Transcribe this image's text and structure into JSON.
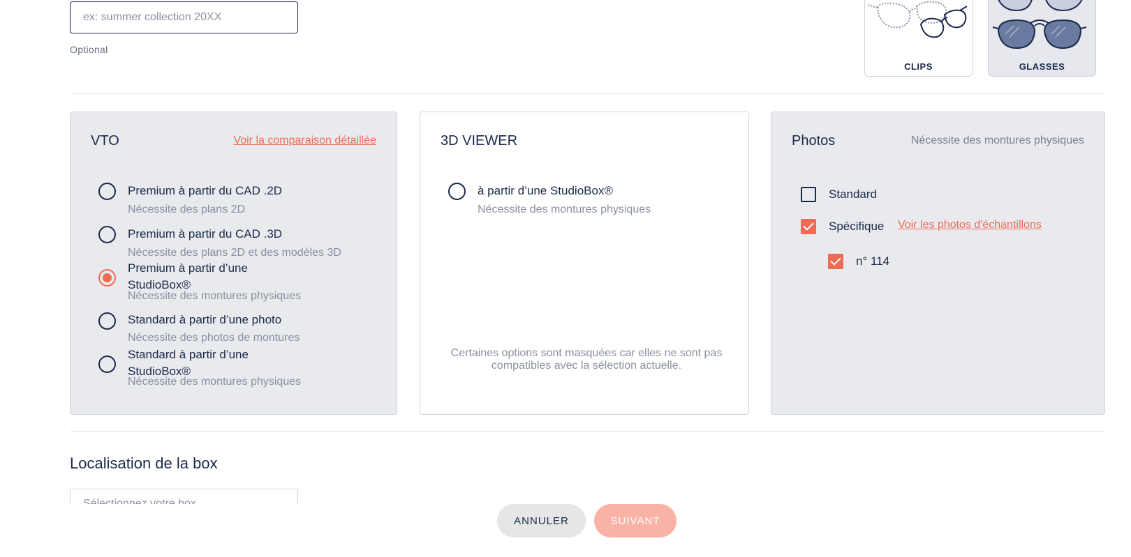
{
  "collection": {
    "placeholder": "ex: summer collection 20XX",
    "hint": "Optional"
  },
  "product_types": [
    {
      "label": "CLIPS",
      "icon": "clip-glasses-icon",
      "selected": false
    },
    {
      "label": "GLASSES",
      "icon": "sunglasses-icon",
      "selected": true
    }
  ],
  "vto": {
    "title": "VTO",
    "link": "Voir la comparaison détaillée",
    "options": [
      {
        "label": "Premium à partir du CAD .2D",
        "sub": "Nécessite des plans 2D",
        "checked": false
      },
      {
        "label": "Premium à partir du CAD .3D",
        "sub": "Nécessite des plans 2D et des modèles 3D",
        "checked": false
      },
      {
        "label": "Premium à partir d’une StudioBox®",
        "sub": "Nécessite des montures physiques",
        "checked": true
      },
      {
        "label": "Standard à partir d’une photo",
        "sub": "Nécessite des photos de montures",
        "checked": false
      },
      {
        "label": "Standard à partir d’une StudioBox®",
        "sub": "Nécessite des montures physiques",
        "checked": false
      }
    ]
  },
  "viewer3d": {
    "title": "3D VIEWER",
    "option": {
      "label": "à partir d’une StudioBox®",
      "sub": "Nécessite des montures physiques",
      "checked": false
    },
    "hidden_note": "Certaines options sont masquées car elles ne sont pas compatibles avec la sélection actuelle."
  },
  "photos": {
    "title": "Photos",
    "note": "Nécessite des montures physiques",
    "standard": {
      "label": "Standard",
      "checked": false
    },
    "specific": {
      "label": "Spécifique",
      "checked": true,
      "link": "Voir les photos d'échantillons"
    },
    "sample": {
      "label": "n° 114",
      "checked": true
    }
  },
  "box_location": {
    "title": "Localisation de la box",
    "placeholder": "Sélectionnez votre box"
  },
  "buttons": {
    "cancel": "ANNULER",
    "next": "SUIVANT"
  },
  "colors": {
    "accent": "#f06a54",
    "navy": "#1b2a4a",
    "panel_grey": "#e9eaee",
    "next_disabled": "#f9b3a6"
  }
}
